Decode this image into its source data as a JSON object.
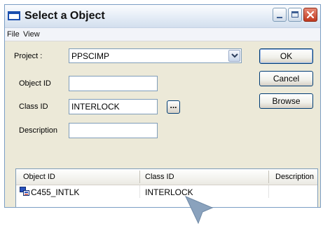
{
  "window": {
    "title": "Select a Object"
  },
  "menu": [
    "File",
    "View"
  ],
  "form": {
    "project_label": "Project :",
    "project_value": "PPSCIMP",
    "object_id_label": "Object ID",
    "object_id_value": "",
    "class_id_label": "Class ID",
    "class_id_value": "INTERLOCK",
    "browse_dots": "...",
    "description_label": "Description",
    "description_value": ""
  },
  "buttons": {
    "ok": "OK",
    "cancel": "Cancel",
    "browse": "Browse"
  },
  "results": {
    "columns": [
      "Object ID",
      "Class ID",
      "Description"
    ],
    "rows": [
      {
        "object_id": "C455_INTLK",
        "class_id": "INTERLOCK",
        "description": ""
      }
    ]
  },
  "icons": {
    "app": "window-icon",
    "row": "object-class-icon",
    "pointer": "mouse-pointer-icon"
  },
  "colors": {
    "titlebar": "#dbe6f3",
    "dialog_bg": "#ece9d8",
    "close": "#c94e33",
    "border": "#7f9db9"
  }
}
